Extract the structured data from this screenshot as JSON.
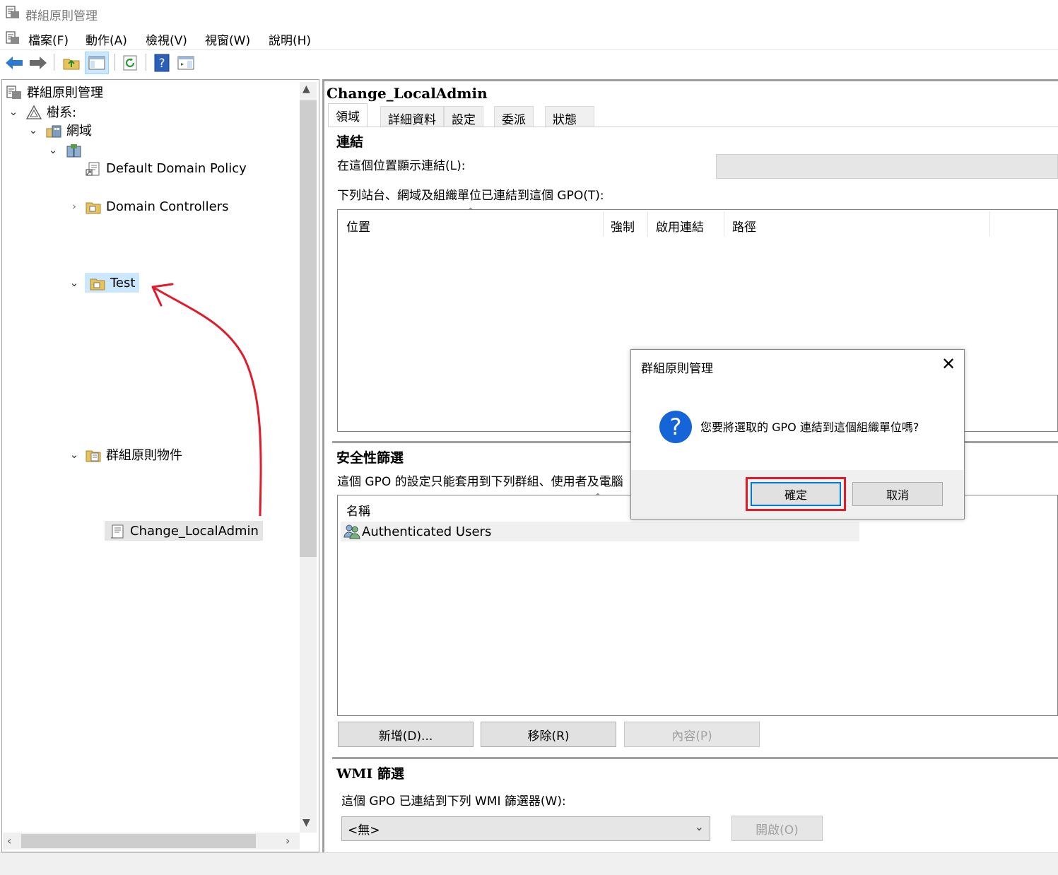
{
  "window": {
    "title": "群組原則管理"
  },
  "menu": [
    {
      "label": "檔案(F)"
    },
    {
      "label": "動作(A)"
    },
    {
      "label": "檢視(V)"
    },
    {
      "label": "視窗(W)"
    },
    {
      "label": "說明(H)"
    }
  ],
  "toolbar": {
    "icons": [
      "back-arrow-icon",
      "forward-arrow-icon",
      "up-folder-icon",
      "show-hide-tree-icon",
      "refresh-icon",
      "help-icon",
      "action-pane-icon"
    ]
  },
  "tree": {
    "root": "群組原則管理",
    "forest": "樹系:",
    "domains": "網域",
    "items": [
      {
        "label": "Default Domain Policy"
      },
      {
        "label": "Domain Controllers"
      },
      {
        "label": "Test"
      },
      {
        "label": "群組原則物件"
      },
      {
        "label": "Change_LocalAdmin"
      }
    ]
  },
  "content": {
    "title": "Change_LocalAdmin",
    "tabs": [
      "領域",
      "詳細資料",
      "設定",
      "委派",
      "狀態"
    ],
    "links": {
      "heading": "連結",
      "location_label": "在這個位置顯示連結(L):",
      "desc": "下列站台、網域及組織單位已連結到這個 GPO(T):",
      "columns": [
        "位置",
        "強制",
        "啟用連結",
        "路徑"
      ]
    },
    "security": {
      "heading": "安全性篩選",
      "desc": "這個 GPO 的設定只能套用到下列群組、使用者及電腦",
      "column": "名稱",
      "rows": [
        "Authenticated Users"
      ],
      "buttons": {
        "add": "新增(D)...",
        "remove": "移除(R)",
        "properties": "內容(P)"
      }
    },
    "wmi": {
      "heading": "WMI 篩選",
      "desc": "這個 GPO 已連結到下列 WMI 篩選器(W):",
      "selected": "<無>",
      "open_button": "開啟(O)"
    }
  },
  "dialog": {
    "title": "群組原則管理",
    "message": "您要將選取的 GPO 連結到這個組織單位嗎?",
    "ok": "確定",
    "cancel": "取消"
  },
  "colors": {
    "annotation": "#e21b2b",
    "selection": "#cce8ff",
    "question_icon": "#1565d8"
  }
}
